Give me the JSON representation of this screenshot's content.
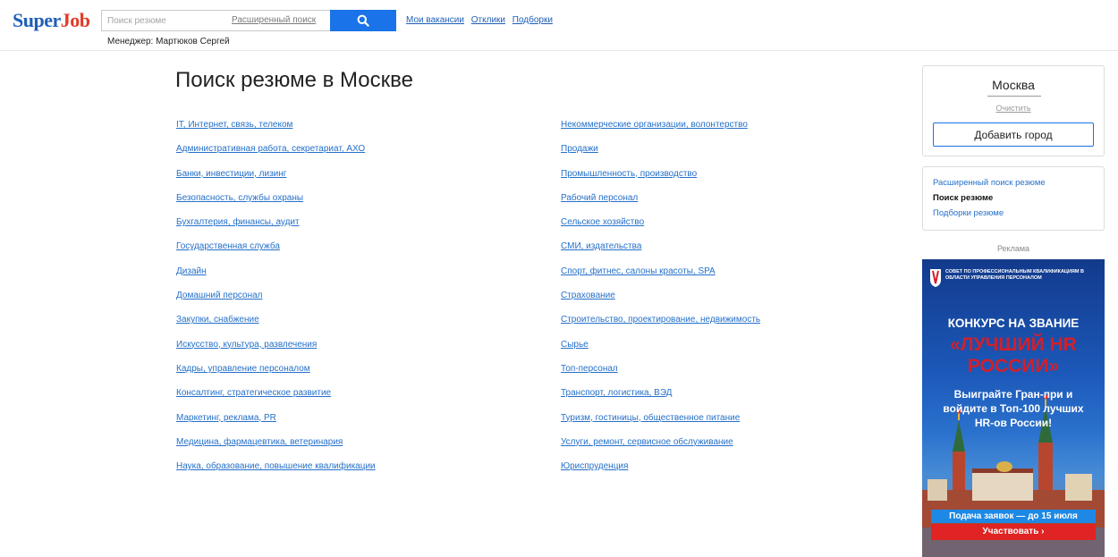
{
  "header": {
    "logo_main": "Super",
    "logo_accent": "Job",
    "search_placeholder": "Поиск резюме",
    "advanced_search": "Расширенный поиск",
    "nav": [
      "Мои вакансии",
      "Отклики",
      "Подборки"
    ],
    "manager": "Менеджер: Мартюков Сергей"
  },
  "main": {
    "title": "Поиск резюме в Москве",
    "categories_left": [
      "IT, Интернет, связь, телеком",
      "Административная работа, секретариат, АХО",
      "Банки, инвестиции, лизинг",
      "Безопасность, службы охраны",
      "Бухгалтерия, финансы, аудит",
      "Государственная служба",
      "Дизайн",
      "Домашний персонал",
      "Закупки, снабжение",
      "Искусство, культура, развлечения",
      "Кадры, управление персоналом",
      "Консалтинг, стратегическое развитие",
      "Маркетинг, реклама, PR",
      "Медицина, фармацевтика, ветеринария",
      "Наука, образование, повышение квалификации"
    ],
    "categories_right": [
      "Некоммерческие организации, волонтерство",
      "Продажи",
      "Промышленность, производство",
      "Рабочий персонал",
      "Сельское хозяйство",
      "СМИ, издательства",
      "Спорт, фитнес, салоны красоты, SPA",
      "Страхование",
      "Строительство, проектирование, недвижимость",
      "Сырье",
      "Топ-персонал",
      "Транспорт, логистика, ВЭД",
      "Туризм, гостиницы, общественное питание",
      "Услуги, ремонт, сервисное обслуживание",
      "Юриспруденция"
    ]
  },
  "sidebar": {
    "city": "Москва",
    "clear": "Очистить",
    "add_city": "Добавить город",
    "links": {
      "advanced": "Расширенный поиск резюме",
      "current": "Поиск резюме",
      "collections": "Подборки резюме"
    },
    "ad_label": "Реклама"
  },
  "ad": {
    "org": "Совет по профессиональным квалификациям в области управления персоналом",
    "line1": "КОНКУРС НА ЗВАНИЕ",
    "line2": "«ЛУЧШИЙ HR",
    "line3": "РОССИИ»",
    "body": "Выиграйте Гран-при и войдите в Топ-100 лучших HR-ов России!",
    "deadline": "Подача заявок — до 15 июля",
    "cta": "Участвовать ›"
  },
  "colors": {
    "brand": "#1f5fb8",
    "brand_accent": "#e03b2a",
    "link": "#2570c9",
    "search_button": "#1a73e8"
  },
  "icons": {
    "search_button": "search-icon",
    "ad_logo": "shield-icon"
  }
}
